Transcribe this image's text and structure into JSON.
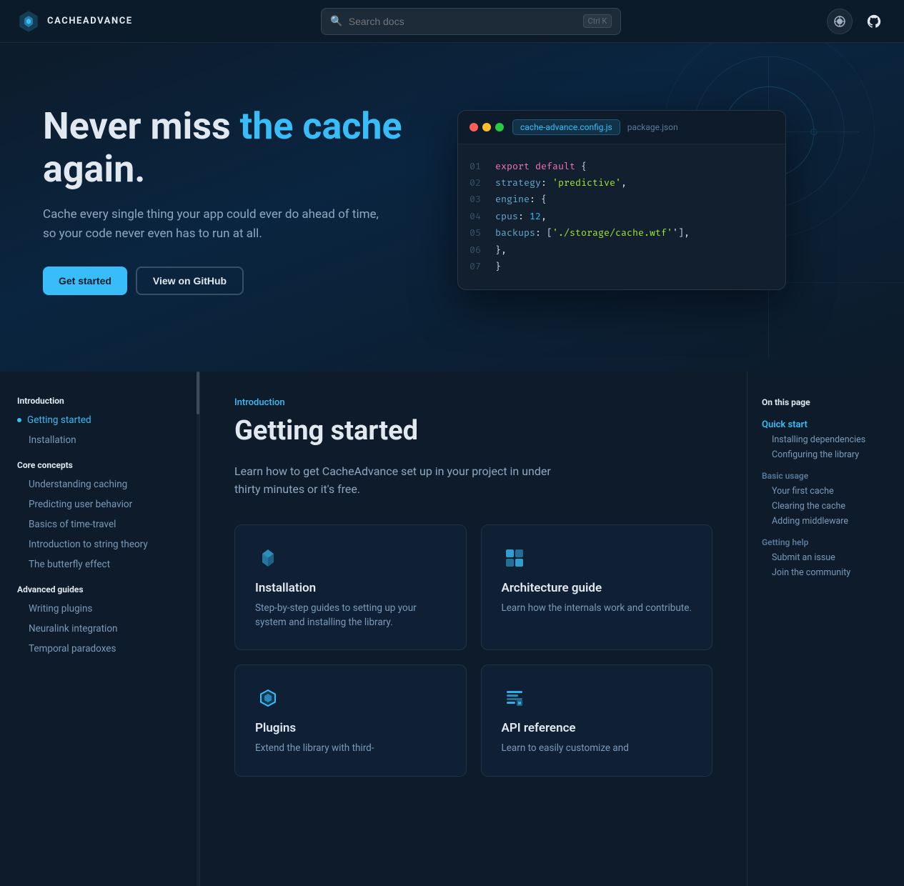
{
  "navbar": {
    "logo_text": "CACHEADVANCE",
    "search_placeholder": "Search docs",
    "search_shortcut": "Ctrl K"
  },
  "hero": {
    "title_part1": "Never miss ",
    "title_highlight": "the cache",
    "title_part2": " again.",
    "description": "Cache every single thing your app could ever do ahead of time, so your code never even has to run at all.",
    "btn_primary": "Get started",
    "btn_secondary": "View on GitHub"
  },
  "code_window": {
    "tab_active": "cache-advance.config.js",
    "tab_inactive": "package.json",
    "lines": [
      {
        "num": "01",
        "content": [
          {
            "type": "kw",
            "t": "export "
          },
          {
            "type": "kw",
            "t": "default"
          },
          {
            "type": "plain",
            "t": " {"
          }
        ]
      },
      {
        "num": "02",
        "content": [
          {
            "type": "key",
            "t": "    strategy"
          },
          {
            "type": "plain",
            "t": ": "
          },
          {
            "type": "str",
            "t": "'predictive'"
          },
          {
            "type": "plain",
            "t": ","
          }
        ]
      },
      {
        "num": "03",
        "content": [
          {
            "type": "key",
            "t": "    engine"
          },
          {
            "type": "plain",
            "t": ": {"
          }
        ]
      },
      {
        "num": "04",
        "content": [
          {
            "type": "key",
            "t": "        cpus"
          },
          {
            "type": "plain",
            "t": ": "
          },
          {
            "type": "num",
            "t": "12"
          },
          {
            "type": "plain",
            "t": ","
          }
        ]
      },
      {
        "num": "05",
        "content": [
          {
            "type": "key",
            "t": "        backups"
          },
          {
            "type": "plain",
            "t": ": ["
          },
          {
            "type": "str",
            "t": "'./storage/cache.wtf'"
          },
          {
            "type": "plain",
            "t": "'],"
          }
        ]
      },
      {
        "num": "06",
        "content": [
          {
            "type": "plain",
            "t": "    },"
          }
        ]
      },
      {
        "num": "07",
        "content": [
          {
            "type": "plain",
            "t": "}"
          }
        ]
      }
    ]
  },
  "sidebar": {
    "sections": [
      {
        "title": "Introduction",
        "items": [
          {
            "label": "Getting started",
            "active": true,
            "sub": false,
            "hasDot": true
          },
          {
            "label": "Installation",
            "active": false,
            "sub": true,
            "hasDot": false
          }
        ]
      },
      {
        "title": "Core concepts",
        "items": [
          {
            "label": "Understanding caching",
            "active": false,
            "sub": true,
            "hasDot": false
          },
          {
            "label": "Predicting user behavior",
            "active": false,
            "sub": true,
            "hasDot": false
          },
          {
            "label": "Basics of time-travel",
            "active": false,
            "sub": true,
            "hasDot": false
          },
          {
            "label": "Introduction to string theory",
            "active": false,
            "sub": true,
            "hasDot": false
          },
          {
            "label": "The butterfly effect",
            "active": false,
            "sub": true,
            "hasDot": false
          }
        ]
      },
      {
        "title": "Advanced guides",
        "items": [
          {
            "label": "Writing plugins",
            "active": false,
            "sub": true,
            "hasDot": false
          },
          {
            "label": "Neuralink integration",
            "active": false,
            "sub": true,
            "hasDot": false
          },
          {
            "label": "Temporal paradoxes",
            "active": false,
            "sub": true,
            "hasDot": false
          }
        ]
      }
    ]
  },
  "content": {
    "breadcrumb": "Introduction",
    "title": "Getting started",
    "description": "Learn how to get CacheAdvance set up in your project in under thirty minutes or it's free.",
    "cards": [
      {
        "id": "installation",
        "title": "Installation",
        "description": "Step-by-step guides to setting up your system and installing the library.",
        "icon": "install"
      },
      {
        "id": "architecture-guide",
        "title": "Architecture guide",
        "description": "Learn how the internals work and contribute.",
        "icon": "arch"
      },
      {
        "id": "plugins",
        "title": "Plugins",
        "description": "Extend the library with third-",
        "icon": "plugin"
      },
      {
        "id": "api-reference",
        "title": "API reference",
        "description": "Learn to easily customize and",
        "icon": "api"
      }
    ]
  },
  "toc": {
    "title": "On this page",
    "sections": [
      {
        "items": [
          {
            "label": "Quick start",
            "active": true,
            "sub": false
          },
          {
            "label": "Installing dependencies",
            "sub": true
          },
          {
            "label": "Configuring the library",
            "sub": true
          }
        ]
      },
      {
        "label": "Basic usage",
        "items": [
          {
            "label": "Your first cache",
            "sub": true
          },
          {
            "label": "Clearing the cache",
            "sub": true
          },
          {
            "label": "Adding middleware",
            "sub": true
          }
        ]
      },
      {
        "label": "Getting help",
        "items": [
          {
            "label": "Submit an issue",
            "sub": true
          },
          {
            "label": "Join the community",
            "sub": true
          }
        ]
      }
    ]
  }
}
